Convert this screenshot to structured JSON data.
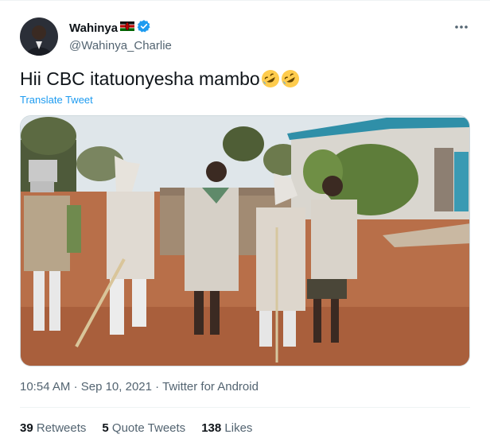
{
  "author": {
    "display_name": "Wahinya",
    "flag_icon": "kenya-flag-icon",
    "verified_icon": "verified-badge-icon",
    "handle": "@Wahinya_Charlie"
  },
  "more_icon": "more-options-icon",
  "tweet": {
    "text": "Hii CBC itatuonyesha mambo",
    "emoji_icon": "rolling-on-floor-laughing-icon",
    "translate_label": "Translate Tweet"
  },
  "media": {
    "description_icon": "photo"
  },
  "meta": {
    "time": "10:54 AM",
    "date": "Sep 10, 2021",
    "source": "Twitter for Android",
    "separator": "·"
  },
  "stats": [
    {
      "count": "39",
      "label": "Retweets"
    },
    {
      "count": "5",
      "label": "Quote Tweets"
    },
    {
      "count": "138",
      "label": "Likes"
    }
  ],
  "colors": {
    "link": "#1d9bf0",
    "verified": "#1d9bf0",
    "muted": "#536471"
  }
}
